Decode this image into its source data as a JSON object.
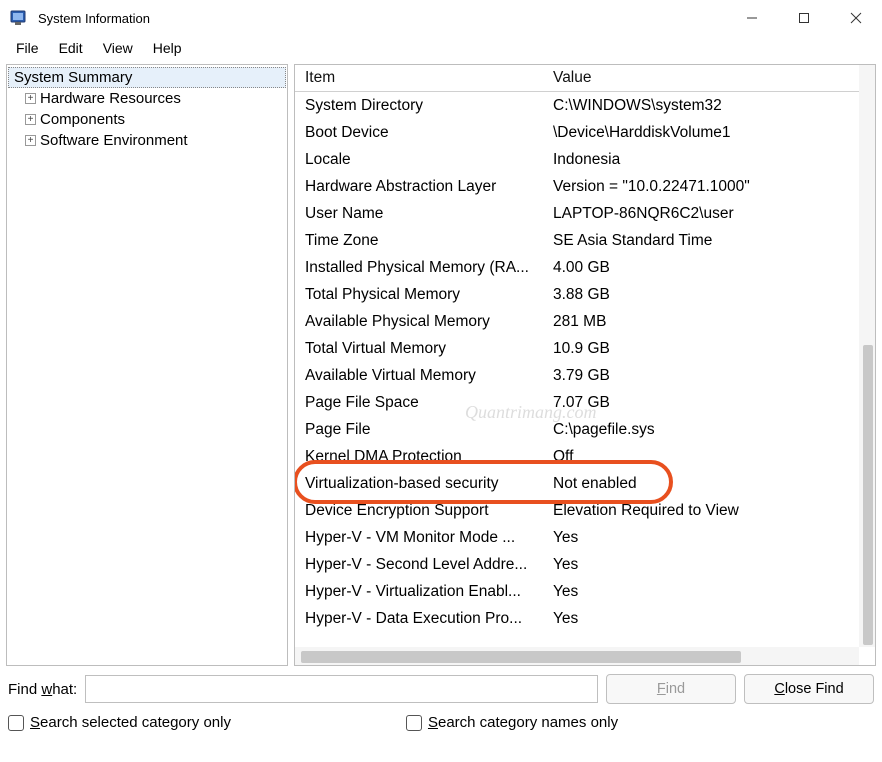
{
  "window": {
    "title": "System Information"
  },
  "menu": {
    "file": "File",
    "edit": "Edit",
    "view": "View",
    "help": "Help"
  },
  "tree": {
    "root": "System Summary",
    "children": [
      "Hardware Resources",
      "Components",
      "Software Environment"
    ]
  },
  "columns": {
    "item": "Item",
    "value": "Value"
  },
  "rows": [
    {
      "item": "System Directory",
      "value": "C:\\WINDOWS\\system32"
    },
    {
      "item": "Boot Device",
      "value": "\\Device\\HarddiskVolume1"
    },
    {
      "item": "Locale",
      "value": "Indonesia"
    },
    {
      "item": "Hardware Abstraction Layer",
      "value": "Version = \"10.0.22471.1000\""
    },
    {
      "item": "User Name",
      "value": "LAPTOP-86NQR6C2\\user"
    },
    {
      "item": "Time Zone",
      "value": "SE Asia Standard Time"
    },
    {
      "item": "Installed Physical Memory (RA...",
      "value": "4.00 GB"
    },
    {
      "item": "Total Physical Memory",
      "value": "3.88 GB"
    },
    {
      "item": "Available Physical Memory",
      "value": "281 MB"
    },
    {
      "item": "Total Virtual Memory",
      "value": "10.9 GB"
    },
    {
      "item": "Available Virtual Memory",
      "value": "3.79 GB"
    },
    {
      "item": "Page File Space",
      "value": "7.07 GB"
    },
    {
      "item": "Page File",
      "value": "C:\\pagefile.sys"
    },
    {
      "item": "Kernel DMA Protection",
      "value": "Off"
    },
    {
      "item": "Virtualization-based security",
      "value": "Not enabled"
    },
    {
      "item": "Device Encryption Support",
      "value": "Elevation Required to View"
    },
    {
      "item": "Hyper-V - VM Monitor Mode ...",
      "value": "Yes"
    },
    {
      "item": "Hyper-V - Second Level Addre...",
      "value": "Yes"
    },
    {
      "item": "Hyper-V - Virtualization Enabl...",
      "value": "Yes"
    },
    {
      "item": "Hyper-V - Data Execution Pro...",
      "value": "Yes"
    }
  ],
  "find": {
    "label_pre": "Find ",
    "label_u": "w",
    "label_post": "hat:",
    "value": "",
    "find_u": "F",
    "find_post": "ind",
    "close_pre": "",
    "close_u": "C",
    "close_post": "lose Find"
  },
  "checks": {
    "c1_u": "S",
    "c1_post": "earch selected category only",
    "c2_u": "S",
    "c2_post": "earch category names only"
  },
  "watermark": "Quantrimang.com"
}
